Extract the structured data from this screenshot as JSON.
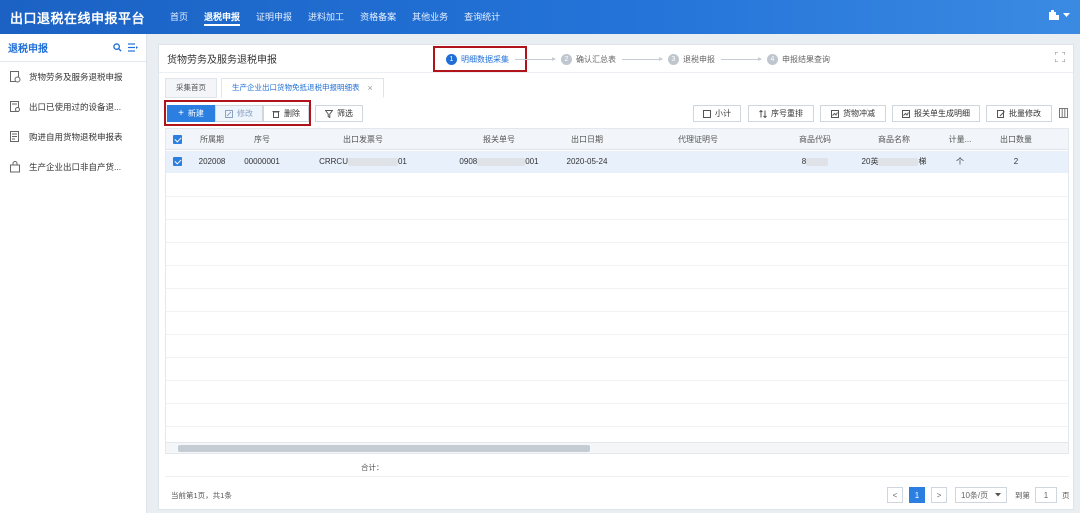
{
  "app": {
    "title": "出口退税在线申报平台"
  },
  "nav": [
    {
      "label": "首页",
      "active": false
    },
    {
      "label": "退税申报",
      "active": true
    },
    {
      "label": "证明申报",
      "active": false
    },
    {
      "label": "进料加工",
      "active": false
    },
    {
      "label": "资格备案",
      "active": false
    },
    {
      "label": "其他业务",
      "active": false
    },
    {
      "label": "查询统计",
      "active": false
    }
  ],
  "sidebar": {
    "title": "退税申报",
    "items": [
      {
        "label": "货物劳务及服务退税申报",
        "icon": "shield-doc-icon"
      },
      {
        "label": "出口已使用过的设备退...",
        "icon": "doc-search-icon"
      },
      {
        "label": "购进自用货物退税申报表",
        "icon": "doc-list-icon"
      },
      {
        "label": "生产企业出口非自产货...",
        "icon": "lock-doc-icon"
      }
    ]
  },
  "page": {
    "title": "货物劳务及服务退税申报"
  },
  "steps": [
    {
      "num": "1",
      "label": "明细数据采集",
      "active": true
    },
    {
      "num": "2",
      "label": "确认汇总表",
      "active": false
    },
    {
      "num": "3",
      "label": "退税申报",
      "active": false
    },
    {
      "num": "4",
      "label": "申报结果查询",
      "active": false
    }
  ],
  "tabs": [
    {
      "label": "采集首页",
      "active": false
    },
    {
      "label": "生产企业出口货物免抵退税申报明细表",
      "active": true,
      "close": "×"
    }
  ],
  "toolbar": {
    "add": "新建",
    "add_icon": "+",
    "edit": "修改",
    "delete": "删除",
    "filter": "筛选",
    "subtotal": "小计",
    "reorder": "序号重排",
    "offset": "货物冲减",
    "generate": "报关单生成明细",
    "batch_edit": "批量修改"
  },
  "table": {
    "headers": [
      "所属期",
      "序号",
      "出口发票号",
      "报关单号",
      "出口日期",
      "代理证明号",
      "商品代码",
      "商品名称",
      "计量...",
      "出口数量"
    ],
    "rows": [
      {
        "period": "202008",
        "seq": "00000001",
        "invoice_prefix": "CRRCU",
        "invoice_suffix": "01",
        "customs_prefix": "0908",
        "customs_suffix": "001",
        "export_date": "2020-05-24",
        "agent_no": "",
        "product_code_prefix": "8",
        "product_name_prefix": "20英",
        "product_name_suffix": "梯",
        "unit": "个",
        "quantity": "2"
      }
    ],
    "total_label": "合计："
  },
  "pagination": {
    "info": "当前第1页，共1条",
    "prev": "<",
    "current": "1",
    "next": ">",
    "page_size": "10条/页",
    "goto_label": "到第",
    "goto_value": "1",
    "page_unit": "页"
  }
}
